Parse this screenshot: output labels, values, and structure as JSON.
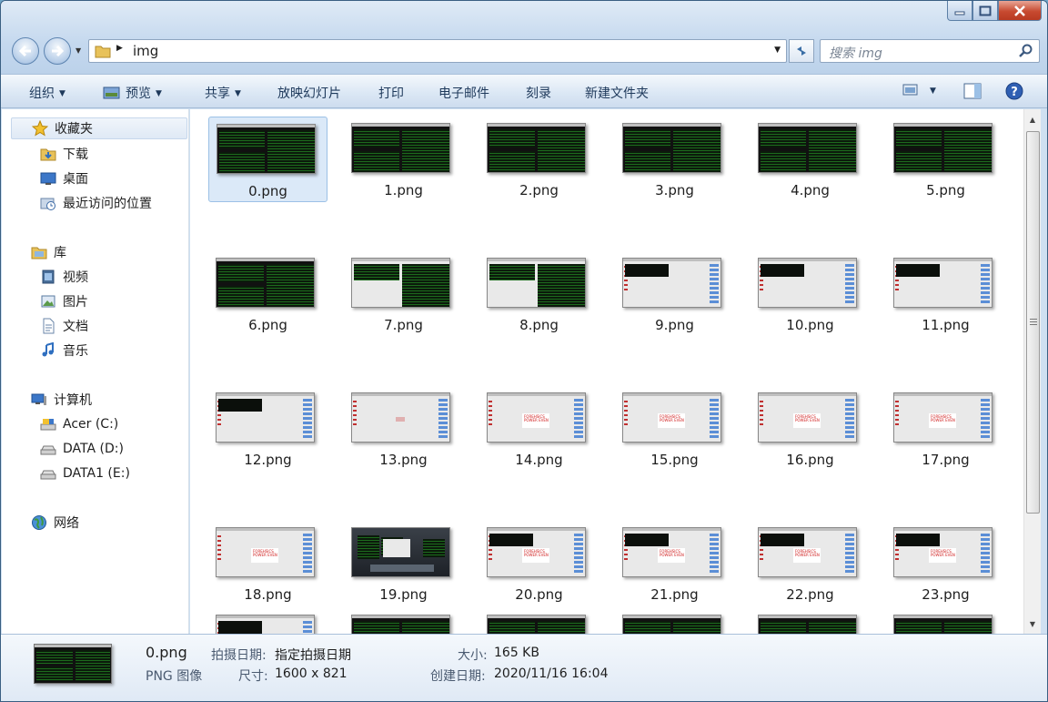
{
  "address": {
    "path": "img"
  },
  "search": {
    "placeholder": "搜索 img"
  },
  "toolbar": {
    "organize": "组织",
    "preview": "预览",
    "share": "共享",
    "slideshow": "放映幻灯片",
    "print": "打印",
    "email": "电子邮件",
    "burn": "刻录",
    "new_folder": "新建文件夹"
  },
  "sidebar": {
    "favorites": "收藏夹",
    "downloads": "下载",
    "desktop": "桌面",
    "recent": "最近访问的位置",
    "libraries": "库",
    "videos": "视频",
    "pictures": "图片",
    "documents": "文档",
    "music": "音乐",
    "computer": "计算机",
    "drive_c": "Acer (C:)",
    "drive_d": "DATA (D:)",
    "drive_e": "DATA1 (E:)",
    "network": "网络"
  },
  "files": [
    {
      "name": "0.png",
      "kind": "terminal"
    },
    {
      "name": "1.png",
      "kind": "terminal"
    },
    {
      "name": "2.png",
      "kind": "terminal"
    },
    {
      "name": "3.png",
      "kind": "terminal"
    },
    {
      "name": "4.png",
      "kind": "terminal"
    },
    {
      "name": "5.png",
      "kind": "terminal"
    },
    {
      "name": "6.png",
      "kind": "terminal"
    },
    {
      "name": "7.png",
      "kind": "terminal-light"
    },
    {
      "name": "8.png",
      "kind": "terminal-light"
    },
    {
      "name": "9.png",
      "kind": "paint"
    },
    {
      "name": "10.png",
      "kind": "paint"
    },
    {
      "name": "11.png",
      "kind": "paint"
    },
    {
      "name": "12.png",
      "kind": "paint"
    },
    {
      "name": "13.png",
      "kind": "paint-blank"
    },
    {
      "name": "14.png",
      "kind": "paint-text"
    },
    {
      "name": "15.png",
      "kind": "paint-text"
    },
    {
      "name": "16.png",
      "kind": "paint-text"
    },
    {
      "name": "17.png",
      "kind": "paint-text"
    },
    {
      "name": "18.png",
      "kind": "paint-text"
    },
    {
      "name": "19.png",
      "kind": "desktop"
    },
    {
      "name": "20.png",
      "kind": "paint-text-term"
    },
    {
      "name": "21.png",
      "kind": "paint-text-term"
    },
    {
      "name": "22.png",
      "kind": "paint-text-term"
    },
    {
      "name": "23.png",
      "kind": "paint-text-term"
    },
    {
      "name": "",
      "kind": "paint"
    },
    {
      "name": "",
      "kind": "terminal"
    },
    {
      "name": "",
      "kind": "terminal"
    },
    {
      "name": "",
      "kind": "terminal"
    },
    {
      "name": "",
      "kind": "terminal"
    },
    {
      "name": "",
      "kind": "terminal"
    }
  ],
  "selected_index": 0,
  "thumb_text": "FOREHSICS POWER EVEN",
  "details": {
    "filename": "0.png",
    "filetype": "PNG 图像",
    "date_taken_label": "拍摄日期:",
    "date_taken_value": "指定拍摄日期",
    "dimensions_label": "尺寸:",
    "dimensions_value": "1600 x 821",
    "size_label": "大小:",
    "size_value": "165 KB",
    "created_label": "创建日期:",
    "created_value": "2020/11/16 16:04"
  },
  "colors": {
    "accent": "#3a6ea5",
    "selection": "#dbe9f8"
  }
}
